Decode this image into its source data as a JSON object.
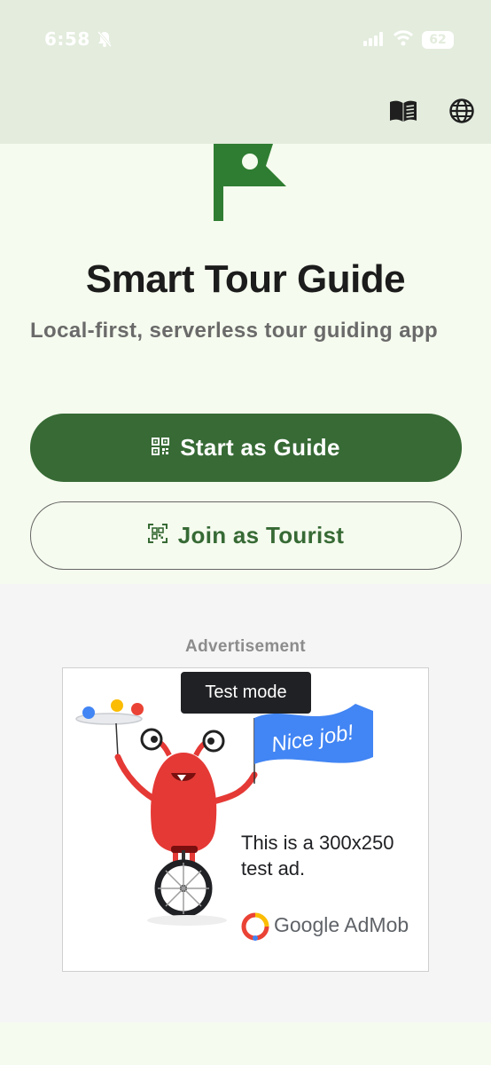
{
  "status_bar": {
    "time": "6:58",
    "battery": "62"
  },
  "hero": {
    "title": "Smart Tour Guide",
    "subtitle": "Local-first, serverless tour guiding app"
  },
  "buttons": {
    "start_guide": "Start as Guide",
    "join_tourist": "Join as Tourist"
  },
  "ad": {
    "label": "Advertisement",
    "test_mode": "Test mode",
    "banner_text": "Nice job!",
    "body_line1": "This is a 300x250",
    "body_line2": "test ad.",
    "brand": "Google AdMob"
  },
  "icons": {
    "header": [
      "book-icon",
      "globe-icon"
    ],
    "status": [
      "bell-off-icon",
      "signal-icon",
      "wifi-icon"
    ],
    "buttons": [
      "qr-code-icon",
      "qr-scan-icon"
    ]
  },
  "colors": {
    "primary": "#376a35",
    "header_bg": "#e3ecdd",
    "hero_bg": "#f5fbee",
    "ad_area_bg": "#f5f5f5"
  }
}
